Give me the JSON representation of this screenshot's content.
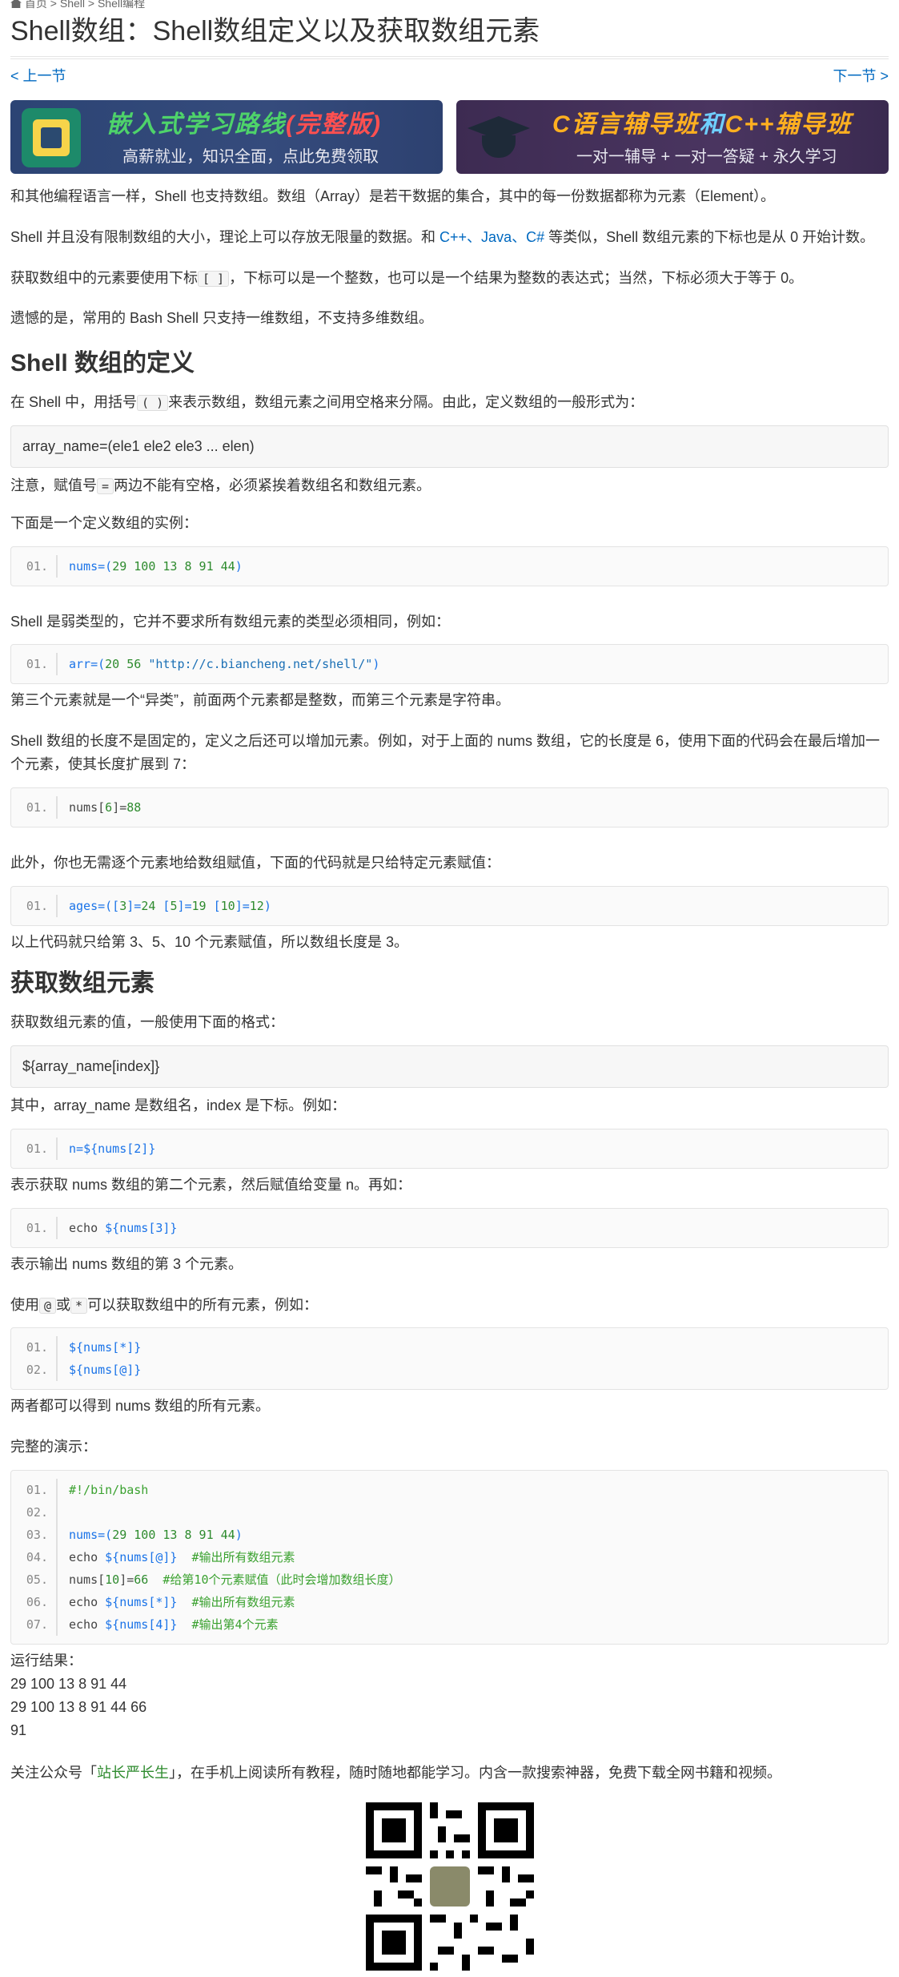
{
  "breadcrumb": {
    "home": "首页",
    "sep1": ">",
    "shell": "Shell",
    "sep2": ">",
    "current": "Shell编程"
  },
  "title": "Shell数组：Shell数组定义以及获取数组元素",
  "nav": {
    "prev": "< 上一节",
    "next": "下一节 >"
  },
  "banner1": {
    "title_a": "嵌入式学习路线",
    "title_b": "(完整版)",
    "sub": "高薪就业，知识全面，点此免费领取"
  },
  "banner2": {
    "title_a": "C语言辅导班",
    "title_b": "和",
    "title_c": "C++辅导班",
    "sub": "一对一辅导 + 一对一答疑 + 永久学习"
  },
  "p1": "和其他编程语言一样，Shell 也支持数组。数组（Array）是若干数据的集合，其中的每一份数据都称为元素（Element）。",
  "p2a": "Shell 并且没有限制数组的大小，理论上可以存放无限量的数据。和 ",
  "p2link": "C++、Java、C#",
  "p2b": " 等类似，Shell 数组元素的下标也是从 0 开始计数。",
  "p3a": "获取数组中的元素要使用下标",
  "p3code": "[ ]",
  "p3b": "，下标可以是一个整数，也可以是一个结果为整数的表达式；当然，下标必须大于等于 0。",
  "p4": "遗憾的是，常用的 Bash Shell 只支持一维数组，不支持多维数组。",
  "h_def": "Shell 数组的定义",
  "d1a": "在 Shell 中，用括号",
  "d1code": "( )",
  "d1b": "来表示数组，数组元素之间用空格来分隔。由此，定义数组的一般形式为：",
  "d_pre": "array_name=(ele1  ele2  ele3 ... elen)",
  "d2a": "注意，赋值号",
  "d2code": "=",
  "d2b": "两边不能有空格，必须紧挨着数组名和数组元素。",
  "d3": "下面是一个定义数组的实例：",
  "c1": {
    "no": "01.",
    "a": "nums=(",
    "b": "29 100 13 8 91 44",
    "c": ")"
  },
  "d4": "Shell 是弱类型的，它并不要求所有数组元素的类型必须相同，例如：",
  "c2": {
    "no": "01.",
    "a": "arr=(",
    "b": "20 56 ",
    "c": "\"http://c.biancheng.net/shell/\"",
    "d": ")"
  },
  "d5": "第三个元素就是一个“异类”，前面两个元素都是整数，而第三个元素是字符串。",
  "d6": "Shell 数组的长度不是固定的，定义之后还可以增加元素。例如，对于上面的 nums 数组，它的长度是 6，使用下面的代码会在最后增加一个元素，使其长度扩展到 7：",
  "c3": {
    "no": "01.",
    "a": "nums[",
    "b": "6",
    "c": "]=",
    "d": "88"
  },
  "d7": "此外，你也无需逐个元素地给数组赋值，下面的代码就是只给特定元素赋值：",
  "c4": {
    "no": "01.",
    "a": "ages=([",
    "b": "3",
    "c": "]=",
    "d": "24",
    "e": " [",
    "f": "5",
    "g": "]=",
    "h": "19",
    "i": " [",
    "j": "10",
    "k": "]=",
    "l": "12",
    "m": ")"
  },
  "d8": "以上代码就只给第 3、5、10 个元素赋值，所以数组长度是 3。",
  "h_get": "获取数组元素",
  "g1": "获取数组元素的值，一般使用下面的格式：",
  "g_pre": "${array_name[index]}",
  "g2": "其中，array_name 是数组名，index 是下标。例如：",
  "c5": {
    "no": "01.",
    "a": "n=",
    "b": "${nums[2]}"
  },
  "g3": "表示获取 nums 数组的第二个元素，然后赋值给变量 n。再如：",
  "c6": {
    "no": "01.",
    "a": "echo ",
    "b": "${nums[3]}"
  },
  "g4": "表示输出 nums 数组的第 3 个元素。",
  "g5a": "使用",
  "g5code1": "@",
  "g5mid": "或",
  "g5code2": "*",
  "g5b": "可以获取数组中的所有元素，例如：",
  "c7": [
    {
      "no": "01.",
      "t": "${nums[*]}"
    },
    {
      "no": "02.",
      "t": "${nums[@]}"
    }
  ],
  "g6": "两者都可以得到 nums 数组的所有元素。",
  "g7": "完整的演示：",
  "demo": {
    "l1": {
      "no": "01.",
      "t": "#!/bin/bash"
    },
    "l2": {
      "no": "02."
    },
    "l3": {
      "no": "03.",
      "a": "nums=(",
      "b": "29 100 13 8 91 44",
      "c": ")"
    },
    "l4": {
      "no": "04.",
      "a": "echo ",
      "b": "${nums[@]}",
      "c": "  #输出所有数组元素"
    },
    "l5": {
      "no": "05.",
      "a": "nums[",
      "b": "10",
      "c": "]=",
      "d": "66",
      "e": "  #给第10个元素赋值（此时会增加数组长度）"
    },
    "l6": {
      "no": "06.",
      "a": "echo ",
      "b": "${nums[*]}",
      "c": "  #输出所有数组元素"
    },
    "l7": {
      "no": "07.",
      "a": "echo ",
      "b": "${nums[4]}",
      "c": "  #输出第4个元素"
    }
  },
  "result_label": "运行结果：",
  "result": [
    "29 100 13 8 91 44",
    "29 100 13 8 91 44 66",
    "91"
  ],
  "follow_a": "关注公众号「",
  "follow_name": "站长严长生",
  "follow_b": "」，在手机上阅读所有教程，随时随地都能学习。内含一款搜索神器，免费下载全网书籍和视频。",
  "colors": {
    "link": "#0069c0",
    "keyword": "#1a73e8",
    "number": "#2e8b2e",
    "comment": "#3aa12f"
  },
  "icons": [
    "home-icon",
    "chip-icon",
    "graduation-cap-icon",
    "qr-code"
  ]
}
